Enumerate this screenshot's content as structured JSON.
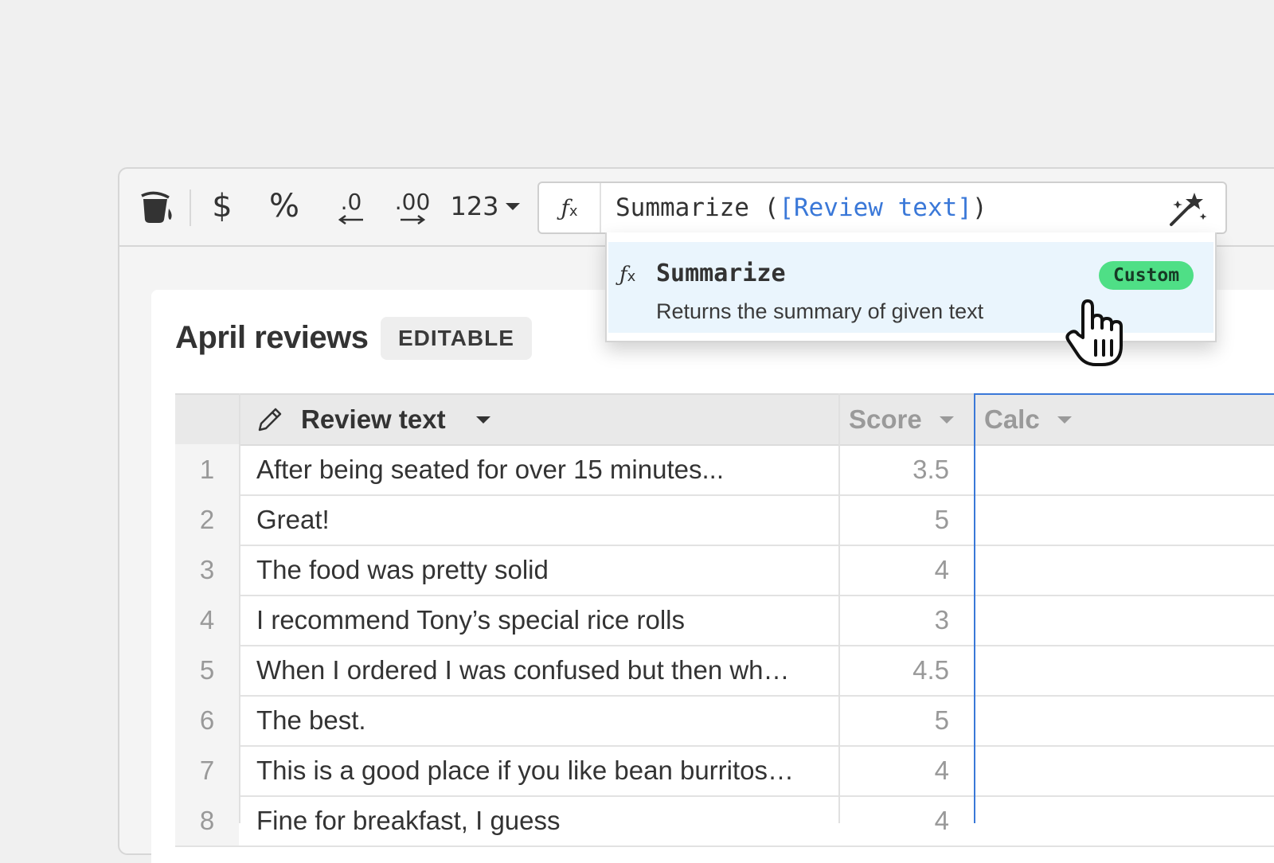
{
  "toolbar": {
    "currency_symbol": "$",
    "percent_symbol": "%",
    "decrease_decimal_label": ".0",
    "increase_decimal_label": ".00",
    "number_format_label": "123",
    "icons": [
      "paint-bucket-icon",
      "dollar-icon",
      "percent-icon",
      "decrease-decimal-icon",
      "increase-decimal-icon",
      "number-format-icon",
      "chevron-down-icon"
    ]
  },
  "formula": {
    "fx_label": "ƒ",
    "fx_sub": "x",
    "function_name": "Summarize (",
    "reference": "[Review text]",
    "closing": ")",
    "magic_icon": "magic-wand-icon"
  },
  "autocomplete": {
    "fx_label": "ƒ",
    "fx_sub": "x",
    "name": "Summarize",
    "description": "Returns the summary of given text",
    "tag": "Custom",
    "tag_color": "#4fdf86"
  },
  "sheet": {
    "title": "April reviews",
    "badge": "EDITABLE",
    "columns": [
      {
        "label": "Review text",
        "icon": "pencil-icon"
      },
      {
        "label": "Score"
      },
      {
        "label": "Calc"
      }
    ],
    "rows": [
      {
        "num": "1",
        "text": "After being seated for over 15 minutes...",
        "score": "3.5"
      },
      {
        "num": "2",
        "text": "Great!",
        "score": "5"
      },
      {
        "num": "3",
        "text": "The food was pretty solid",
        "score": "4"
      },
      {
        "num": "4",
        "text": "I recommend Tony’s special rice rolls",
        "score": "3"
      },
      {
        "num": "5",
        "text": "When I ordered I was confused but then wh…",
        "score": "4.5"
      },
      {
        "num": "6",
        "text": "The best.",
        "score": "5"
      },
      {
        "num": "7",
        "text": "This is a good place if you like bean burritos…",
        "score": "4"
      },
      {
        "num": "8",
        "text": "Fine for breakfast, I guess",
        "score": "4"
      }
    ]
  },
  "colors": {
    "accent_blue": "#3a78d8",
    "custom_tag": "#4fdf86",
    "highlight": "#eaf5fd"
  }
}
